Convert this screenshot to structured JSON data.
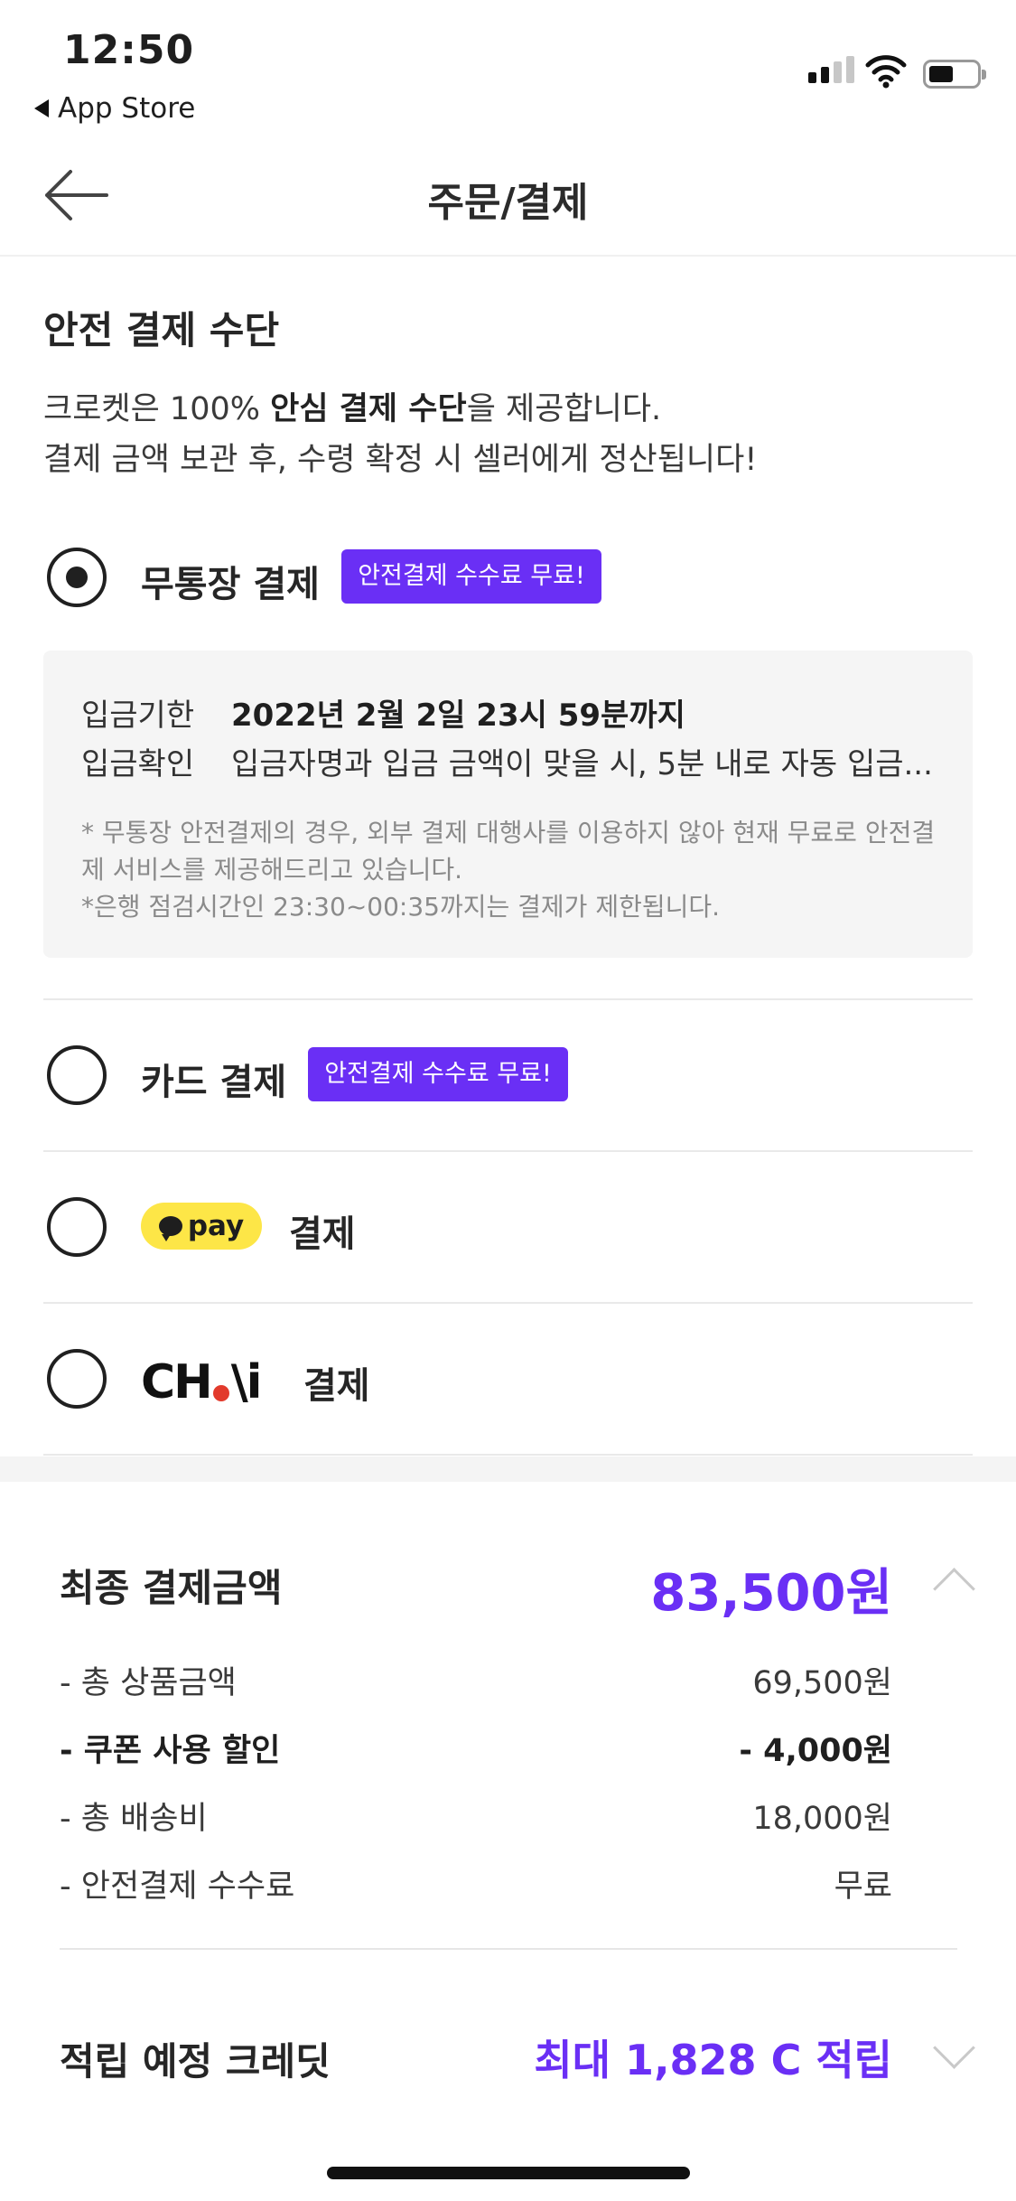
{
  "status_bar": {
    "time": "12:50",
    "back_app_label": "App Store"
  },
  "header": {
    "title": "주문/결제"
  },
  "section": {
    "title": "안전 결제 수단",
    "desc_line1_pre": "크로켓은 100% ",
    "desc_line1_bold": "안심 결제 수단",
    "desc_line1_post": "을 제공합니다.",
    "desc_line2": "결제 금액 보관 후, 수령 확정 시 셀러에게 정산됩니다!"
  },
  "options": {
    "bank": {
      "label": "무통장 결제",
      "badge": "안전결제 수수료 무료!",
      "selected": true
    },
    "card": {
      "label": "카드 결제",
      "badge": "안전결제 수수료 무료!",
      "selected": false
    },
    "kakaopay": {
      "logo_text": "pay",
      "label": "결제",
      "selected": false
    },
    "chai": {
      "logo_left": "CH",
      "logo_right": "\\i",
      "label": "결제",
      "selected": false
    }
  },
  "bank_info": {
    "deadline_key": "입금기한",
    "deadline_value": "2022년 2월 2일 23시 59분까지",
    "confirm_key": "입금확인",
    "confirm_value": "입금자명과 입금 금액이 맞을 시, 5분 내로 자동 입금...",
    "note1": "* 무통장 안전결제의 경우, 외부 결제 대행사를 이용하지 않아 현재 무료로 안전결",
    "note2": "제 서비스를 제공해드리고 있습니다.",
    "note3": "*은행 점검시간인 23:30~00:35까지는 결제가 제한됩니다."
  },
  "summary": {
    "total_label": "최종 결제금액",
    "total_amount": "83,500원",
    "rows": [
      {
        "label": "- 총 상품금액",
        "value": "69,500원"
      },
      {
        "label": "- 쿠폰 사용 할인",
        "value": "- 4,000원"
      },
      {
        "label": "- 총 배송비",
        "value": "18,000원"
      },
      {
        "label": "- 안전결제 수수료",
        "value": "무료"
      }
    ],
    "credit_label": "적립 예정 크레딧",
    "credit_value": "최대 1,828 C 적립"
  },
  "colors": {
    "accent": "#6a2ff5",
    "kakao_yellow": "#fde647",
    "chai_red": "#e23a2c"
  }
}
